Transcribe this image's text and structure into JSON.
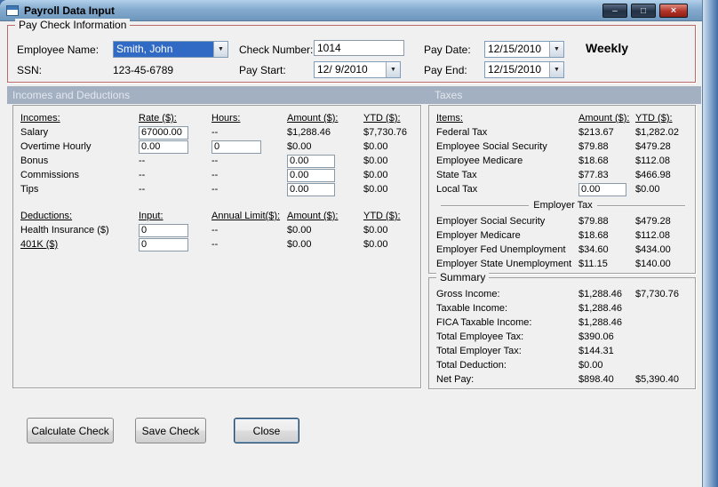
{
  "window": {
    "title": "Payroll Data Input",
    "controls": {
      "minimize": "–",
      "maximize": "□",
      "close": "×"
    }
  },
  "paycheck": {
    "group_title": "Pay Check Information",
    "employee_name": {
      "label": "Employee Name:",
      "value": "Smith, John"
    },
    "ssn": {
      "label": "SSN:",
      "value": "123-45-6789"
    },
    "check_number": {
      "label": "Check Number:",
      "value": "1014"
    },
    "pay_start": {
      "label": "Pay Start:",
      "value": "12/ 9/2010"
    },
    "pay_date": {
      "label": "Pay Date:",
      "value": "12/15/2010"
    },
    "pay_end": {
      "label": "Pay End:",
      "value": "12/15/2010"
    },
    "frequency": "Weekly"
  },
  "sections": {
    "incomes_header": "Incomes and Deductions",
    "taxes_header": "Taxes"
  },
  "incomes": {
    "headers": {
      "name": "Incomes:",
      "rate": "Rate ($):",
      "hours": "Hours:",
      "amount": "Amount ($):",
      "ytd": "YTD ($):"
    },
    "rows": [
      {
        "label": "Salary",
        "rate": "67000.00",
        "hours": "--",
        "amount": "$1,288.46",
        "ytd": "$7,730.76"
      },
      {
        "label": "Overtime Hourly",
        "rate": "0.00",
        "hours": "0",
        "amount": "$0.00",
        "ytd": "$0.00"
      },
      {
        "label": "Bonus",
        "rate": "--",
        "hours": "--",
        "amount": "0.00",
        "ytd": "$0.00"
      },
      {
        "label": "Commissions",
        "rate": "--",
        "hours": "--",
        "amount": "0.00",
        "ytd": "$0.00"
      },
      {
        "label": "Tips",
        "rate": "--",
        "hours": "--",
        "amount": "0.00",
        "ytd": "$0.00"
      }
    ]
  },
  "deductions": {
    "headers": {
      "name": "Deductions:",
      "input": "Input:",
      "limit": "Annual Limit($):",
      "amount": "Amount ($):",
      "ytd": "YTD ($):"
    },
    "rows": [
      {
        "label": "Health Insurance  ($)",
        "input": "0",
        "limit": "--",
        "amount": "$0.00",
        "ytd": "$0.00"
      },
      {
        "label": "401K  ($)",
        "input": "0",
        "limit": "--",
        "amount": "$0.00",
        "ytd": "$0.00"
      }
    ]
  },
  "taxes": {
    "headers": {
      "name": "Items:",
      "amount": "Amount ($):",
      "ytd": "YTD ($):"
    },
    "employee_rows": [
      {
        "label": "Federal Tax",
        "amount": "$213.67",
        "ytd": "$1,282.02"
      },
      {
        "label": "Employee Social Security",
        "amount": "$79.88",
        "ytd": "$479.28"
      },
      {
        "label": "Employee Medicare",
        "amount": "$18.68",
        "ytd": "$112.08"
      },
      {
        "label": "State Tax",
        "amount": "$77.83",
        "ytd": "$466.98"
      },
      {
        "label": "Local Tax",
        "amount": "0.00",
        "ytd": "$0.00"
      }
    ],
    "employer_header": "Employer Tax",
    "employer_rows": [
      {
        "label": "Employer Social Security",
        "amount": "$79.88",
        "ytd": "$479.28"
      },
      {
        "label": "Employer Medicare",
        "amount": "$18.68",
        "ytd": "$112.08"
      },
      {
        "label": "Employer Fed Unemployment",
        "amount": "$34.60",
        "ytd": "$434.00"
      },
      {
        "label": "Employer State Unemployment",
        "amount": "$11.15",
        "ytd": "$140.00"
      }
    ]
  },
  "summary": {
    "group_title": "Summary",
    "rows": [
      {
        "label": "Gross Income:",
        "amount": "$1,288.46",
        "ytd": "$7,730.76"
      },
      {
        "label": "Taxable Income:",
        "amount": "$1,288.46",
        "ytd": ""
      },
      {
        "label": "FICA Taxable Income:",
        "amount": "$1,288.46",
        "ytd": ""
      },
      {
        "label": "Total Employee Tax:",
        "amount": "$390.06",
        "ytd": ""
      },
      {
        "label": "Total Employer Tax:",
        "amount": "$144.31",
        "ytd": ""
      },
      {
        "label": "Total Deduction:",
        "amount": "$0.00",
        "ytd": ""
      },
      {
        "label": "Net Pay:",
        "amount": "$898.40",
        "ytd": "$5,390.40"
      }
    ]
  },
  "buttons": {
    "calculate": "Calculate Check",
    "save": "Save Check",
    "close": "Close"
  }
}
